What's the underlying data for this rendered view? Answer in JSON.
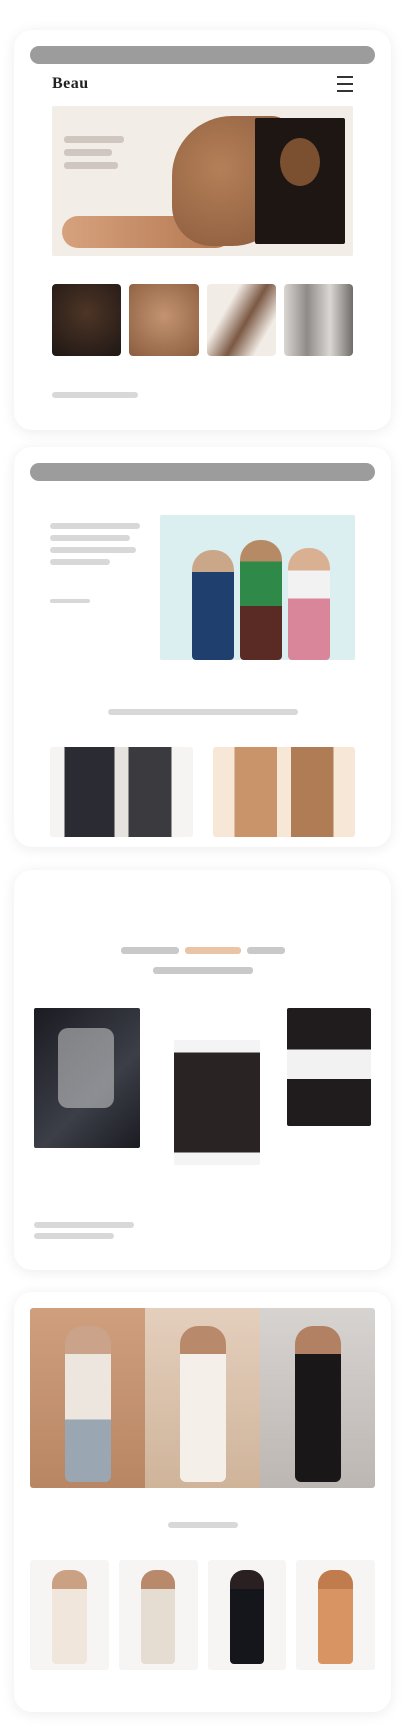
{
  "card1": {
    "logo": "Beau",
    "hero_text": "",
    "thumb_captions": [
      "",
      "",
      "",
      ""
    ],
    "footer_note": ""
  },
  "card2": {
    "headline": "",
    "cta": "",
    "section_title": ""
  },
  "card3": {
    "title_line1": "",
    "title_accent": "",
    "title_line1_end": "",
    "title_line2": "",
    "link_text": ""
  },
  "card4": {
    "subtitle": ""
  },
  "colors": {
    "accent": "#e0a57a",
    "browser_bar": "#9c9c9c",
    "hero_panel": "#dbeef0"
  },
  "icons": {
    "menu": "menu-icon"
  }
}
